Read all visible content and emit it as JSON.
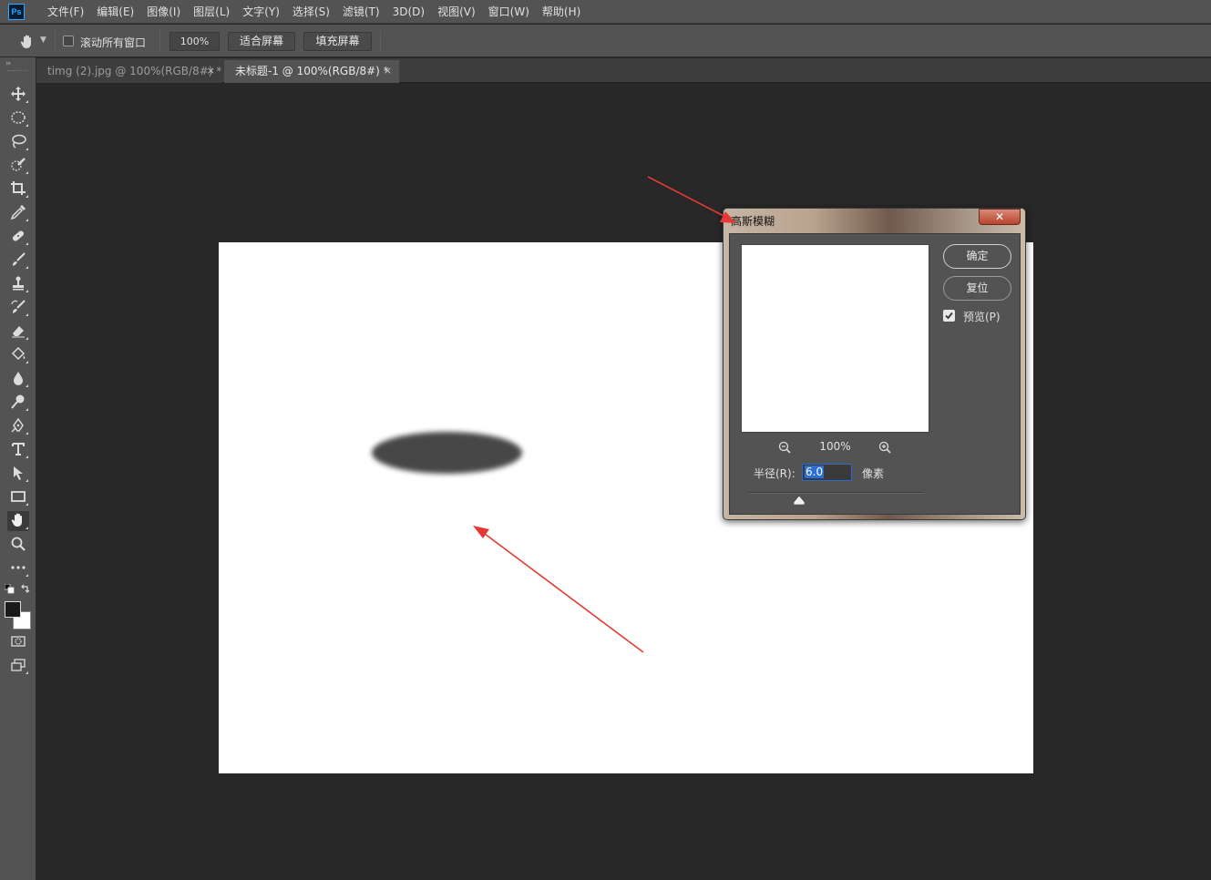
{
  "app": {
    "logo": "Ps"
  },
  "menubar": {
    "items": [
      "文件(F)",
      "编辑(E)",
      "图像(I)",
      "图层(L)",
      "文字(Y)",
      "选择(S)",
      "滤镜(T)",
      "3D(D)",
      "视图(V)",
      "窗口(W)",
      "帮助(H)"
    ]
  },
  "options": {
    "scroll_all_label": "滚动所有窗口",
    "zoom_value": "100%",
    "fit_screen_label": "适合屏幕",
    "fill_screen_label": "填充屏幕"
  },
  "tabs": [
    {
      "label": "timg (2).jpg @ 100%(RGB/8#) *",
      "close": "×",
      "active": false
    },
    {
      "label": "未标题-1 @ 100%(RGB/8#) *",
      "close": "×",
      "active": true
    }
  ],
  "toolbar": {
    "grip": "››",
    "tools": [
      "move-icon",
      "marquee-ellipse-icon",
      "lasso-icon",
      "quick-select-icon",
      "crop-icon",
      "eyedropper-icon",
      "healing-brush-icon",
      "brush-icon",
      "clone-stamp-icon",
      "history-brush-icon",
      "eraser-icon",
      "paint-bucket-icon",
      "blur-icon",
      "dodge-icon",
      "pen-icon",
      "type-icon",
      "path-select-icon",
      "rectangle-icon",
      "hand-icon",
      "zoom-icon",
      "more-tools-icon"
    ],
    "active_tool": "hand-icon"
  },
  "dialog": {
    "title": "高斯模糊",
    "close": "✕",
    "ok_label": "确定",
    "reset_label": "复位",
    "preview_label": "预览(P)",
    "preview_checked": true,
    "zoom_value": "100%",
    "radius_label": "半径(R):",
    "radius_value": "6.0",
    "radius_unit": "像素"
  },
  "colors": {
    "ui_bg": "#535353",
    "workspace": "#282828",
    "annotation_arrow": "#e53935",
    "accent_blue": "#2b6fd6"
  }
}
